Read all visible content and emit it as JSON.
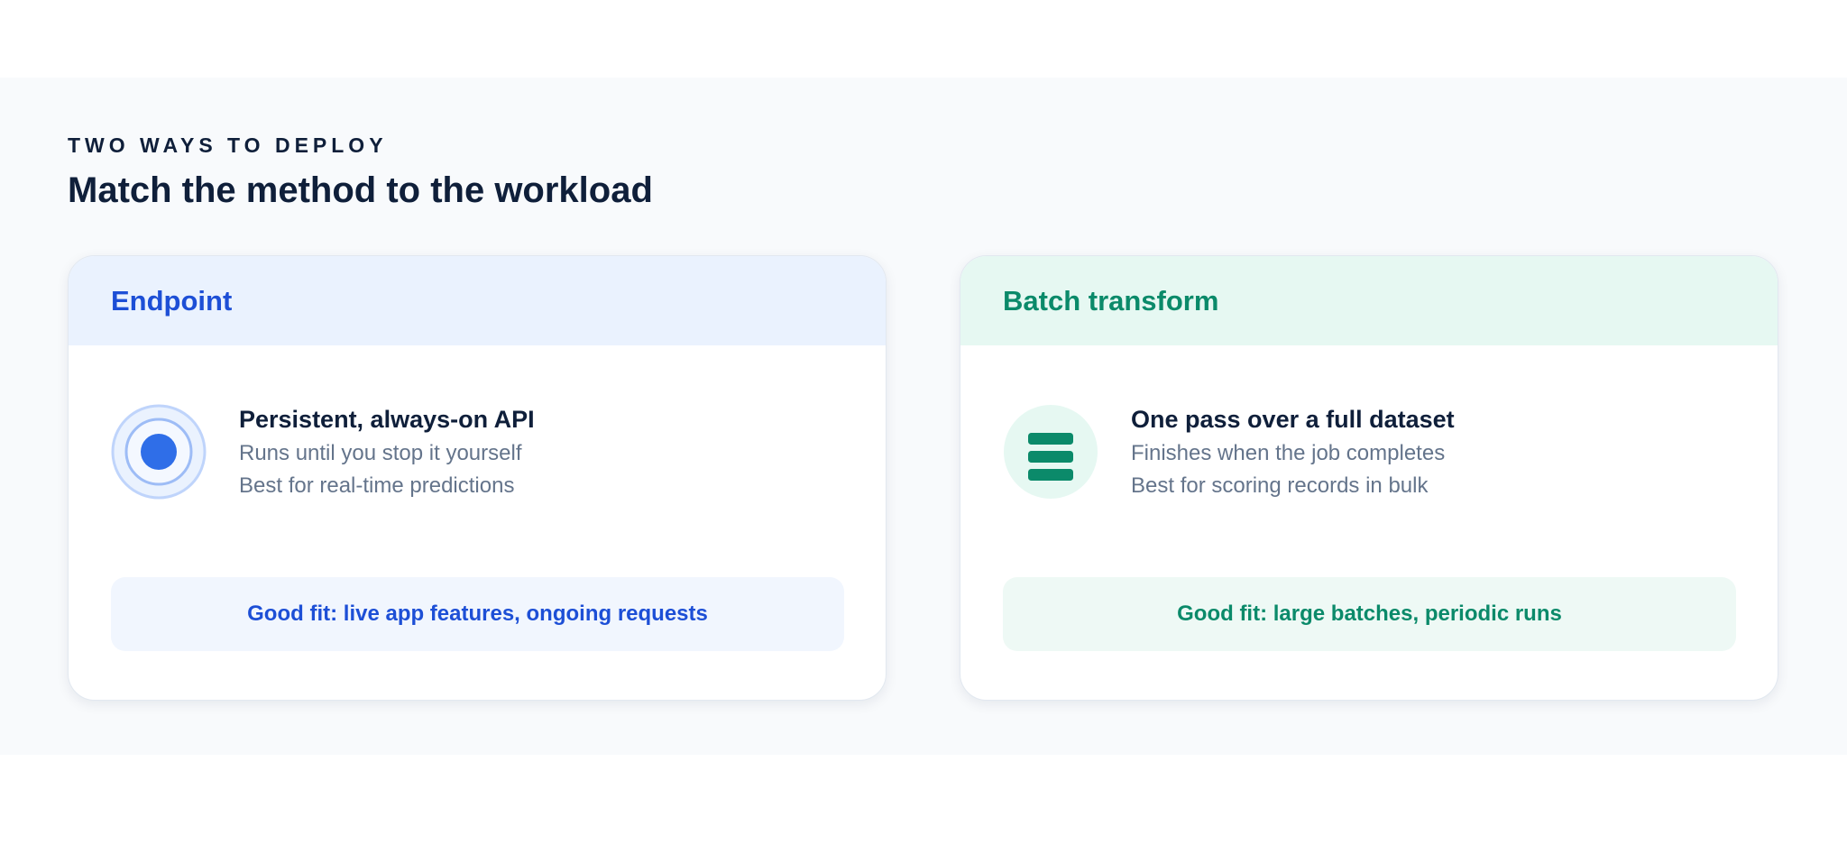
{
  "intro": {
    "eyebrow": "TWO WAYS TO DEPLOY",
    "heading": "Match the method to the workload"
  },
  "cards": [
    {
      "title": "Endpoint",
      "icon": "target-icon",
      "primary": "Persistent, always-on API",
      "lines": [
        "Runs until you stop it yourself",
        "Best for real-time predictions"
      ],
      "fit": "Good fit: live app features, ongoing requests",
      "accent": "#1d4fd6"
    },
    {
      "title": "Batch transform",
      "icon": "stack-icon",
      "primary": "One pass over a full dataset",
      "lines": [
        "Finishes when the job completes",
        "Best for scoring records in bulk"
      ],
      "fit": "Good fit: large batches, periodic runs",
      "accent": "#0b8a6a"
    }
  ]
}
